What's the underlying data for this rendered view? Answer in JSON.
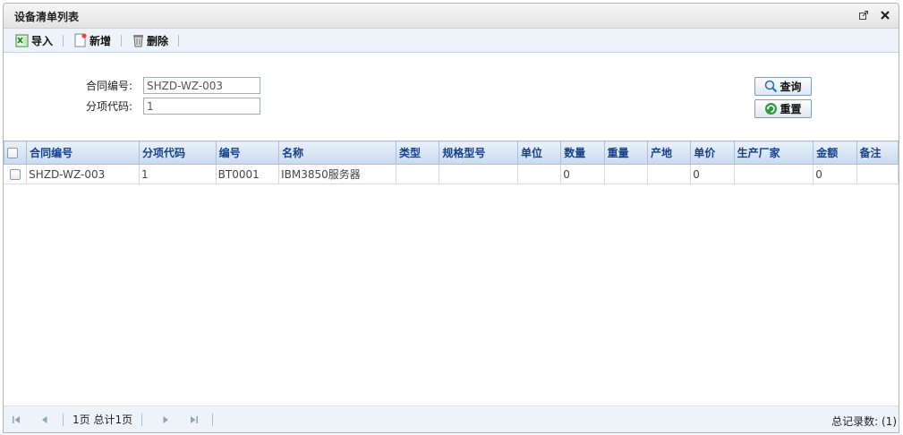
{
  "window": {
    "title": "设备清单列表"
  },
  "toolbar": {
    "import_label": "导入",
    "add_label": "新增",
    "delete_label": "删除"
  },
  "form": {
    "contract_label": "合同编号:",
    "contract_value": "SHZD-WZ-003",
    "item_label": "分项代码:",
    "item_value": "1",
    "query_label": "查询",
    "reset_label": "重置"
  },
  "grid": {
    "columns": [
      "合同编号",
      "分项代码",
      "编号",
      "名称",
      "类型",
      "规格型号",
      "单位",
      "数量",
      "重量",
      "产地",
      "单价",
      "生产厂家",
      "金额",
      "备注"
    ],
    "rows": [
      [
        "SHZD-WZ-003",
        "1",
        "BT0001",
        "IBM3850服务器",
        "",
        "",
        "",
        "0",
        "",
        "",
        "0",
        "",
        "0",
        ""
      ]
    ]
  },
  "pager": {
    "page_text": "1页 总计1页",
    "total_text": "总记录数: (1)"
  },
  "colors": {
    "header_text": "#15428b",
    "toolbar_bg": "#eef3f9"
  }
}
